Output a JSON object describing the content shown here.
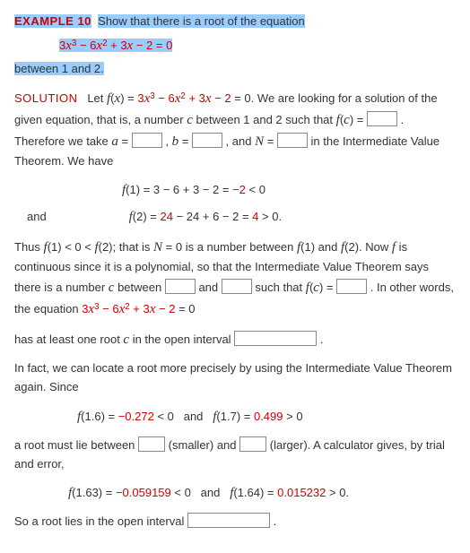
{
  "header": {
    "label": "EXAMPLE 10",
    "prompt": "Show that there is a root of the equation",
    "equation_html": "3<span class='mi'>x</span><sup>3</sup> − 6<span class='mi'>x</span><sup>2</sup> + 3<span class='mi'>x</span> − 2 = 0",
    "tail": "between 1 and 2."
  },
  "sol": {
    "label": "SOLUTION",
    "s1a": "Let ",
    "s1b_html": "<span class='fn'>f</span>(<span class='mi'>x</span>) = <span class='red'>3<span class='mi'>x</span><sup>3</sup> − 6<span class='mi'>x</span><sup>2</sup> + 3<span class='mi'>x</span> − 2</span> = 0.",
    "s1c": " We are looking for a solution of the given equation, that is, a number ",
    "s1c2": " between 1 and 2 such that ",
    "s1d_html": "<span class='fn'>f</span>(<span class='mi'>c</span>) = ",
    "s1e": ". Therefore we take ",
    "s1f_html": "<span class='mi'>a</span> = ",
    "s1g_html": ", <span class='mi'>b</span> = ",
    "s1h": ", and ",
    "s1i_html": "<span class='mi'>N</span> = ",
    "s1j": " in the Intermediate Value Theorem. We have"
  },
  "calc": {
    "f1_html": "<span class='fn'>f</span>(1) = 3 − 6 + 3 − 2 = <span class='red'>−2</span> &lt; 0",
    "and": "and",
    "f2_html": "<span class='fn'>f</span>(2) = <span class='red'>24</span> − 24 + 6 − 2 = <span class='red'>4</span> &gt; 0."
  },
  "p2": {
    "t1_html": "Thus <span class='fn'>f</span>(1) &lt; 0 &lt; <span class='fn'>f</span>(2); that is <span class='mi'>N</span> = 0 is a number between <span class='fn'>f</span>(1) and <span class='fn'>f</span>(2). Now <span class='fn'>f</span> is continuous since it is a polynomial, so that the Intermediate Value Theorem says there is a number <span class='mi'>c</span> between ",
    "t2": " and ",
    "t3_html": " such that <span class='fn'>f</span>(<span class='mi'>c</span>) = ",
    "t4_html": ". In other words, the equation <span class='red'>3<span class='mi'>x</span><sup>3</sup> − 6<span class='mi'>x</span><sup>2</sup> + 3<span class='mi'>x</span> − 2</span> = 0",
    "t5_html": "has at least one root <span class='mi'>c</span> in the open interval "
  },
  "p3": {
    "t1": "In fact, we can locate a root more precisely by using the Intermediate Value Theorem again. Since",
    "row1_html": "<span class='fn'>f</span>(1.6) = <span class='red'>−0.272</span> &lt; 0&nbsp;&nbsp;&nbsp;and&nbsp;&nbsp;&nbsp;<span class='fn'>f</span>(1.7) = <span class='red'>0.499</span> &gt; 0",
    "t2a": "a root must lie between ",
    "t2b": " (smaller) and ",
    "t2c": " (larger). A calculator gives, by trial and error,",
    "row2_html": "<span class='fn'>f</span>(1.63) = <span class='red'>−0.059159</span> &lt; 0&nbsp;&nbsp;&nbsp;and&nbsp;&nbsp;&nbsp;<span class='fn'>f</span>(1.64) = <span class='red'>0.015232</span> &gt; 0.",
    "t3": "So a root lies in the open interval "
  }
}
